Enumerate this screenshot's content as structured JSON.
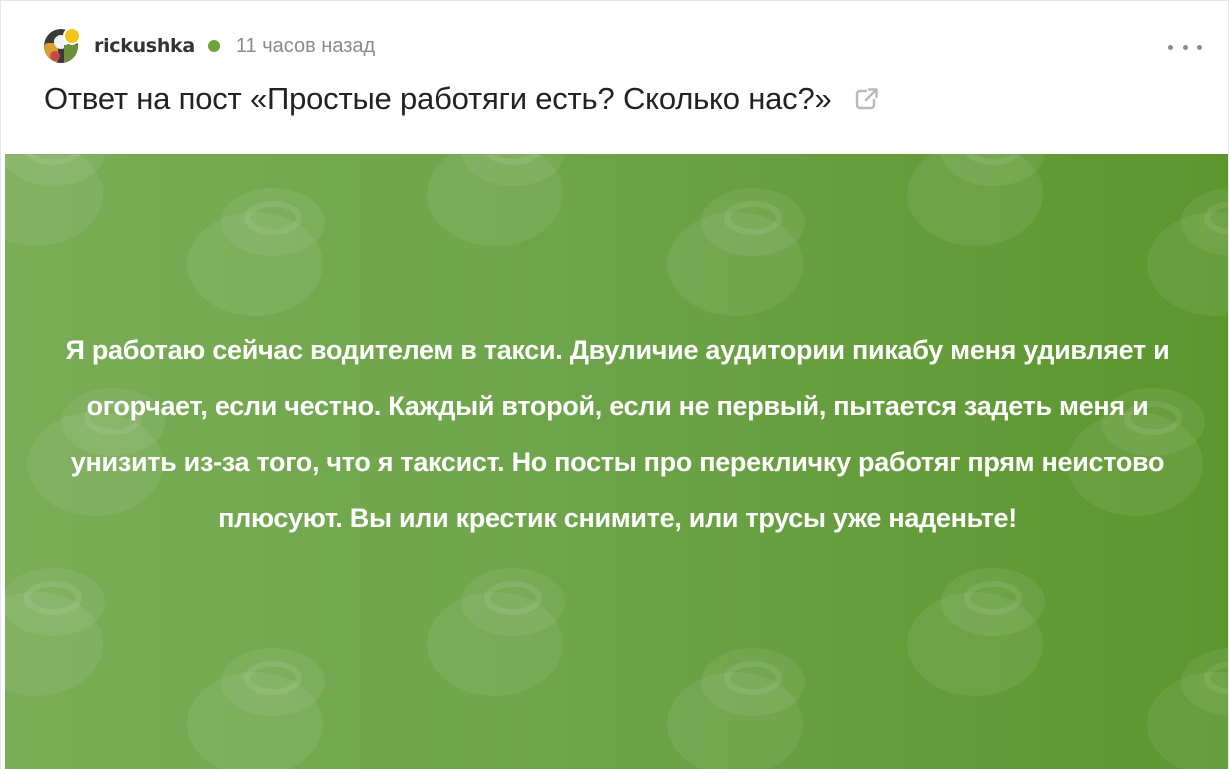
{
  "post": {
    "author": "rickushka",
    "time": "11 часов назад",
    "title": "Ответ на пост «Простые работяги есть? Сколько нас?»"
  },
  "banner": {
    "text": "Я работаю сейчас водителем в такси. Двуличие аудитории пикабу меня удивляет и огорчает, если честно. Каждый второй, если не первый, пытается задеть меня и унизить из-за того, что я таксист. Но посты про перекличку работяг прям неистово плюсуют. Вы или крестик снимите, или трусы уже наденьте!",
    "background_color": "#6ea44a"
  },
  "colors": {
    "online": "#6fa337",
    "badge": "#f5c518"
  },
  "icons": {
    "more": "more-dots-icon",
    "external": "external-link-icon",
    "online": "online-status-icon"
  }
}
